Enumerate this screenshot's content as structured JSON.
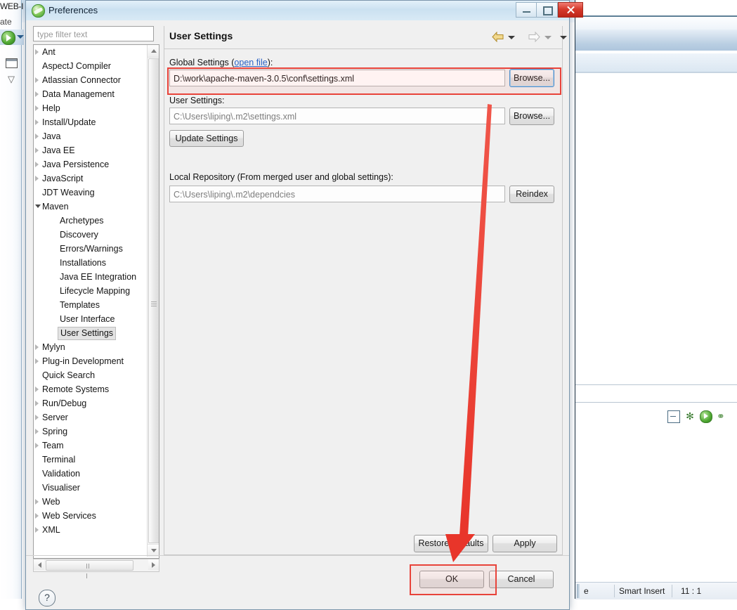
{
  "ide": {
    "menu_fragment_1": "WEB-I",
    "menu_fragment_2": "ate",
    "status": {
      "left_fragment": "e",
      "insert_mode": "Smart Insert",
      "cursor_position": "11 : 1"
    }
  },
  "dialog": {
    "title": "Preferences",
    "window_buttons": {
      "minimize": "minimize-button",
      "maximize": "maximize-button",
      "close": "close-button"
    },
    "filter": {
      "placeholder": "type filter text",
      "value": ""
    },
    "tree": [
      {
        "label": "Ant",
        "depth": 0,
        "state": "collapsed"
      },
      {
        "label": "AspectJ Compiler",
        "depth": 0,
        "state": "leaf"
      },
      {
        "label": "Atlassian Connector",
        "depth": 0,
        "state": "collapsed"
      },
      {
        "label": "Data Management",
        "depth": 0,
        "state": "collapsed"
      },
      {
        "label": "Help",
        "depth": 0,
        "state": "collapsed"
      },
      {
        "label": "Install/Update",
        "depth": 0,
        "state": "collapsed"
      },
      {
        "label": "Java",
        "depth": 0,
        "state": "collapsed"
      },
      {
        "label": "Java EE",
        "depth": 0,
        "state": "collapsed"
      },
      {
        "label": "Java Persistence",
        "depth": 0,
        "state": "collapsed"
      },
      {
        "label": "JavaScript",
        "depth": 0,
        "state": "collapsed"
      },
      {
        "label": "JDT Weaving",
        "depth": 0,
        "state": "leaf"
      },
      {
        "label": "Maven",
        "depth": 0,
        "state": "expanded"
      },
      {
        "label": "Archetypes",
        "depth": 1,
        "state": "leaf"
      },
      {
        "label": "Discovery",
        "depth": 1,
        "state": "leaf"
      },
      {
        "label": "Errors/Warnings",
        "depth": 1,
        "state": "leaf"
      },
      {
        "label": "Installations",
        "depth": 1,
        "state": "leaf"
      },
      {
        "label": "Java EE Integration",
        "depth": 1,
        "state": "leaf"
      },
      {
        "label": "Lifecycle Mapping",
        "depth": 1,
        "state": "leaf"
      },
      {
        "label": "Templates",
        "depth": 1,
        "state": "leaf"
      },
      {
        "label": "User Interface",
        "depth": 1,
        "state": "leaf"
      },
      {
        "label": "User Settings",
        "depth": 1,
        "state": "selected"
      },
      {
        "label": "Mylyn",
        "depth": 0,
        "state": "collapsed"
      },
      {
        "label": "Plug-in Development",
        "depth": 0,
        "state": "collapsed"
      },
      {
        "label": "Quick Search",
        "depth": 0,
        "state": "leaf"
      },
      {
        "label": "Remote Systems",
        "depth": 0,
        "state": "collapsed"
      },
      {
        "label": "Run/Debug",
        "depth": 0,
        "state": "collapsed"
      },
      {
        "label": "Server",
        "depth": 0,
        "state": "collapsed"
      },
      {
        "label": "Spring",
        "depth": 0,
        "state": "collapsed"
      },
      {
        "label": "Team",
        "depth": 0,
        "state": "collapsed"
      },
      {
        "label": "Terminal",
        "depth": 0,
        "state": "leaf"
      },
      {
        "label": "Validation",
        "depth": 0,
        "state": "leaf"
      },
      {
        "label": "Visualiser",
        "depth": 0,
        "state": "leaf"
      },
      {
        "label": "Web",
        "depth": 0,
        "state": "collapsed"
      },
      {
        "label": "Web Services",
        "depth": 0,
        "state": "collapsed"
      },
      {
        "label": "XML",
        "depth": 0,
        "state": "collapsed"
      }
    ],
    "page": {
      "title": "User Settings",
      "global_settings": {
        "label_prefix": "Global Settings (",
        "link_text": "open file",
        "label_suffix": "):",
        "value": "D:\\work\\apache-maven-3.0.5\\conf\\settings.xml",
        "browse_label": "Browse..."
      },
      "user_settings": {
        "label": "User Settings:",
        "value": "C:\\Users\\liping\\.m2\\settings.xml",
        "browse_label": "Browse...",
        "update_label": "Update Settings"
      },
      "local_repository": {
        "label": "Local Repository (From merged user and global settings):",
        "value": "C:\\Users\\liping\\.m2\\dependcies",
        "reindex_label": "Reindex"
      },
      "restore_defaults_label": "Restore Defaults",
      "apply_label": "Apply"
    },
    "footer": {
      "help_glyph": "?",
      "ok_label": "OK",
      "cancel_label": "Cancel"
    },
    "annotation": {
      "accent_color": "#e8433a"
    }
  }
}
